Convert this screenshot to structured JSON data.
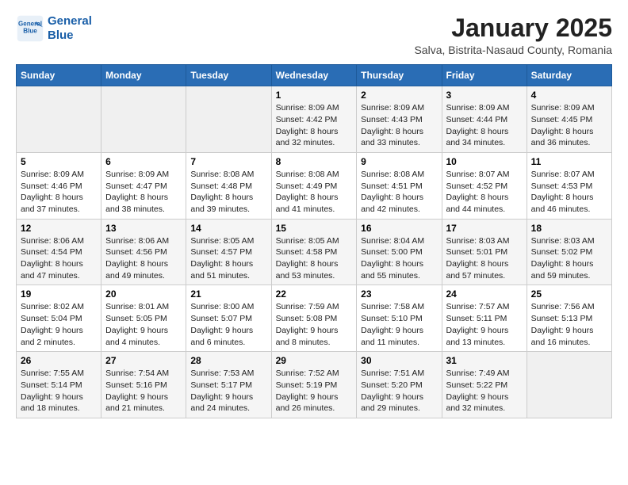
{
  "header": {
    "logo_line1": "General",
    "logo_line2": "Blue",
    "month": "January 2025",
    "location": "Salva, Bistrita-Nasaud County, Romania"
  },
  "weekdays": [
    "Sunday",
    "Monday",
    "Tuesday",
    "Wednesday",
    "Thursday",
    "Friday",
    "Saturday"
  ],
  "weeks": [
    [
      {
        "day": "",
        "info": ""
      },
      {
        "day": "",
        "info": ""
      },
      {
        "day": "",
        "info": ""
      },
      {
        "day": "1",
        "info": "Sunrise: 8:09 AM\nSunset: 4:42 PM\nDaylight: 8 hours and 32 minutes."
      },
      {
        "day": "2",
        "info": "Sunrise: 8:09 AM\nSunset: 4:43 PM\nDaylight: 8 hours and 33 minutes."
      },
      {
        "day": "3",
        "info": "Sunrise: 8:09 AM\nSunset: 4:44 PM\nDaylight: 8 hours and 34 minutes."
      },
      {
        "day": "4",
        "info": "Sunrise: 8:09 AM\nSunset: 4:45 PM\nDaylight: 8 hours and 36 minutes."
      }
    ],
    [
      {
        "day": "5",
        "info": "Sunrise: 8:09 AM\nSunset: 4:46 PM\nDaylight: 8 hours and 37 minutes."
      },
      {
        "day": "6",
        "info": "Sunrise: 8:09 AM\nSunset: 4:47 PM\nDaylight: 8 hours and 38 minutes."
      },
      {
        "day": "7",
        "info": "Sunrise: 8:08 AM\nSunset: 4:48 PM\nDaylight: 8 hours and 39 minutes."
      },
      {
        "day": "8",
        "info": "Sunrise: 8:08 AM\nSunset: 4:49 PM\nDaylight: 8 hours and 41 minutes."
      },
      {
        "day": "9",
        "info": "Sunrise: 8:08 AM\nSunset: 4:51 PM\nDaylight: 8 hours and 42 minutes."
      },
      {
        "day": "10",
        "info": "Sunrise: 8:07 AM\nSunset: 4:52 PM\nDaylight: 8 hours and 44 minutes."
      },
      {
        "day": "11",
        "info": "Sunrise: 8:07 AM\nSunset: 4:53 PM\nDaylight: 8 hours and 46 minutes."
      }
    ],
    [
      {
        "day": "12",
        "info": "Sunrise: 8:06 AM\nSunset: 4:54 PM\nDaylight: 8 hours and 47 minutes."
      },
      {
        "day": "13",
        "info": "Sunrise: 8:06 AM\nSunset: 4:56 PM\nDaylight: 8 hours and 49 minutes."
      },
      {
        "day": "14",
        "info": "Sunrise: 8:05 AM\nSunset: 4:57 PM\nDaylight: 8 hours and 51 minutes."
      },
      {
        "day": "15",
        "info": "Sunrise: 8:05 AM\nSunset: 4:58 PM\nDaylight: 8 hours and 53 minutes."
      },
      {
        "day": "16",
        "info": "Sunrise: 8:04 AM\nSunset: 5:00 PM\nDaylight: 8 hours and 55 minutes."
      },
      {
        "day": "17",
        "info": "Sunrise: 8:03 AM\nSunset: 5:01 PM\nDaylight: 8 hours and 57 minutes."
      },
      {
        "day": "18",
        "info": "Sunrise: 8:03 AM\nSunset: 5:02 PM\nDaylight: 8 hours and 59 minutes."
      }
    ],
    [
      {
        "day": "19",
        "info": "Sunrise: 8:02 AM\nSunset: 5:04 PM\nDaylight: 9 hours and 2 minutes."
      },
      {
        "day": "20",
        "info": "Sunrise: 8:01 AM\nSunset: 5:05 PM\nDaylight: 9 hours and 4 minutes."
      },
      {
        "day": "21",
        "info": "Sunrise: 8:00 AM\nSunset: 5:07 PM\nDaylight: 9 hours and 6 minutes."
      },
      {
        "day": "22",
        "info": "Sunrise: 7:59 AM\nSunset: 5:08 PM\nDaylight: 9 hours and 8 minutes."
      },
      {
        "day": "23",
        "info": "Sunrise: 7:58 AM\nSunset: 5:10 PM\nDaylight: 9 hours and 11 minutes."
      },
      {
        "day": "24",
        "info": "Sunrise: 7:57 AM\nSunset: 5:11 PM\nDaylight: 9 hours and 13 minutes."
      },
      {
        "day": "25",
        "info": "Sunrise: 7:56 AM\nSunset: 5:13 PM\nDaylight: 9 hours and 16 minutes."
      }
    ],
    [
      {
        "day": "26",
        "info": "Sunrise: 7:55 AM\nSunset: 5:14 PM\nDaylight: 9 hours and 18 minutes."
      },
      {
        "day": "27",
        "info": "Sunrise: 7:54 AM\nSunset: 5:16 PM\nDaylight: 9 hours and 21 minutes."
      },
      {
        "day": "28",
        "info": "Sunrise: 7:53 AM\nSunset: 5:17 PM\nDaylight: 9 hours and 24 minutes."
      },
      {
        "day": "29",
        "info": "Sunrise: 7:52 AM\nSunset: 5:19 PM\nDaylight: 9 hours and 26 minutes."
      },
      {
        "day": "30",
        "info": "Sunrise: 7:51 AM\nSunset: 5:20 PM\nDaylight: 9 hours and 29 minutes."
      },
      {
        "day": "31",
        "info": "Sunrise: 7:49 AM\nSunset: 5:22 PM\nDaylight: 9 hours and 32 minutes."
      },
      {
        "day": "",
        "info": ""
      }
    ]
  ]
}
